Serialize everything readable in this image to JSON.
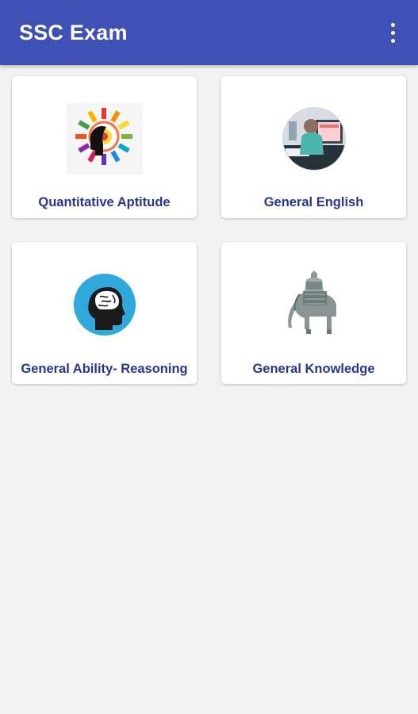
{
  "app_bar": {
    "title": "SSC Exam",
    "menu_icon": "more-vert-icon"
  },
  "categories": [
    {
      "label": "Quantitative Aptitude",
      "icon": "colorful-head-gears-icon"
    },
    {
      "label": "General English",
      "icon": "person-at-computer-icon"
    },
    {
      "label": "General Ability- Reasoning",
      "icon": "brain-head-icon"
    },
    {
      "label": "General Knowledge",
      "icon": "elephant-icon"
    }
  ],
  "colors": {
    "primary": "#3f51b5",
    "label": "#283593",
    "background": "#f2f2f2",
    "reasoning_circle": "#2fa8dc"
  }
}
